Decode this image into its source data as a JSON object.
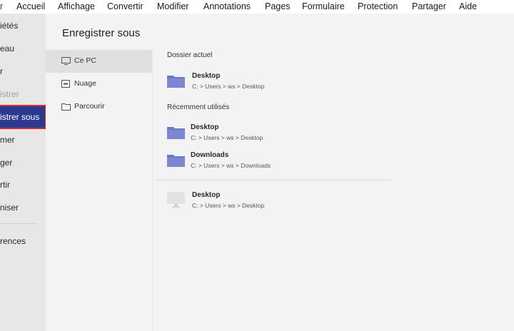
{
  "menubar": {
    "items": [
      {
        "label": "r",
        "active": true
      },
      {
        "label": "Accueil"
      },
      {
        "label": "Affichage"
      },
      {
        "label": "Convertir"
      },
      {
        "label": "Modifier"
      },
      {
        "label": "Annotations"
      },
      {
        "label": "Pages"
      },
      {
        "label": "Formulaire"
      },
      {
        "label": "Protection"
      },
      {
        "label": "Partager"
      },
      {
        "label": "Aide"
      }
    ]
  },
  "backstage": {
    "items": [
      {
        "label": "iétés"
      },
      {
        "label": "eau"
      },
      {
        "label": "r"
      },
      {
        "label": "istrer"
      },
      {
        "label": "istrer sous"
      },
      {
        "label": "mer"
      },
      {
        "label": "ger"
      },
      {
        "label": "rtir"
      },
      {
        "label": "niser"
      },
      {
        "label": "rences"
      }
    ]
  },
  "panel": {
    "title": "Enregistrer sous",
    "locations": [
      {
        "label": "Ce PC",
        "icon": "monitor-icon"
      },
      {
        "label": "Nuage",
        "icon": "cloud-drive-icon"
      },
      {
        "label": "Parcourir",
        "icon": "folder-icon"
      }
    ]
  },
  "current_folder": {
    "title": "Dossier actuel",
    "entries": [
      {
        "name": "Desktop",
        "path": "C: > Users > ws > Desktop"
      }
    ]
  },
  "recent": {
    "title": "Récemment utilisés",
    "entries": [
      {
        "name": "Desktop",
        "path": "C: > Users > ws > Desktop"
      },
      {
        "name": "Downloads",
        "path": "C: > Users > ws > Downloads"
      }
    ]
  },
  "other": {
    "entries": [
      {
        "name": "Desktop",
        "path": "C: > Users > ws > Desktop"
      }
    ]
  },
  "colors": {
    "accent": "#2b3a8e",
    "selected_border": "#d62b2b",
    "folder": "#6e78c9",
    "backstage_bg": "#e7e7e7",
    "content_bg": "#f3f3f3"
  }
}
